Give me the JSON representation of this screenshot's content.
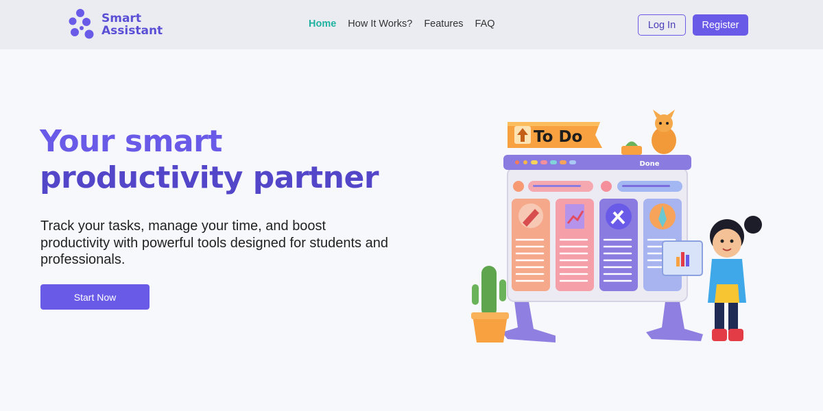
{
  "brand": {
    "line1": "Smart",
    "line2": "Assistant"
  },
  "nav": {
    "items": [
      {
        "label": "Home",
        "active": true
      },
      {
        "label": "How It Works?",
        "active": false
      },
      {
        "label": "Features",
        "active": false
      },
      {
        "label": "FAQ",
        "active": false
      }
    ]
  },
  "auth": {
    "login_label": "Log In",
    "register_label": "Register"
  },
  "hero": {
    "title_line1": "Your smart",
    "title_line2": "productivity partner",
    "subtitle": "Track your tasks, manage your time, and boost productivity with powerful tools designed for students and professionals.",
    "cta_label": "Start Now"
  },
  "illustration": {
    "sign_label": "To Do",
    "board_label": "Done"
  },
  "colors": {
    "accent": "#6a5ae8",
    "accent_dark": "#5446c9",
    "nav_active": "#1fb2a0",
    "header_bg": "#ebecf2",
    "page_bg": "#f7f8fb"
  }
}
